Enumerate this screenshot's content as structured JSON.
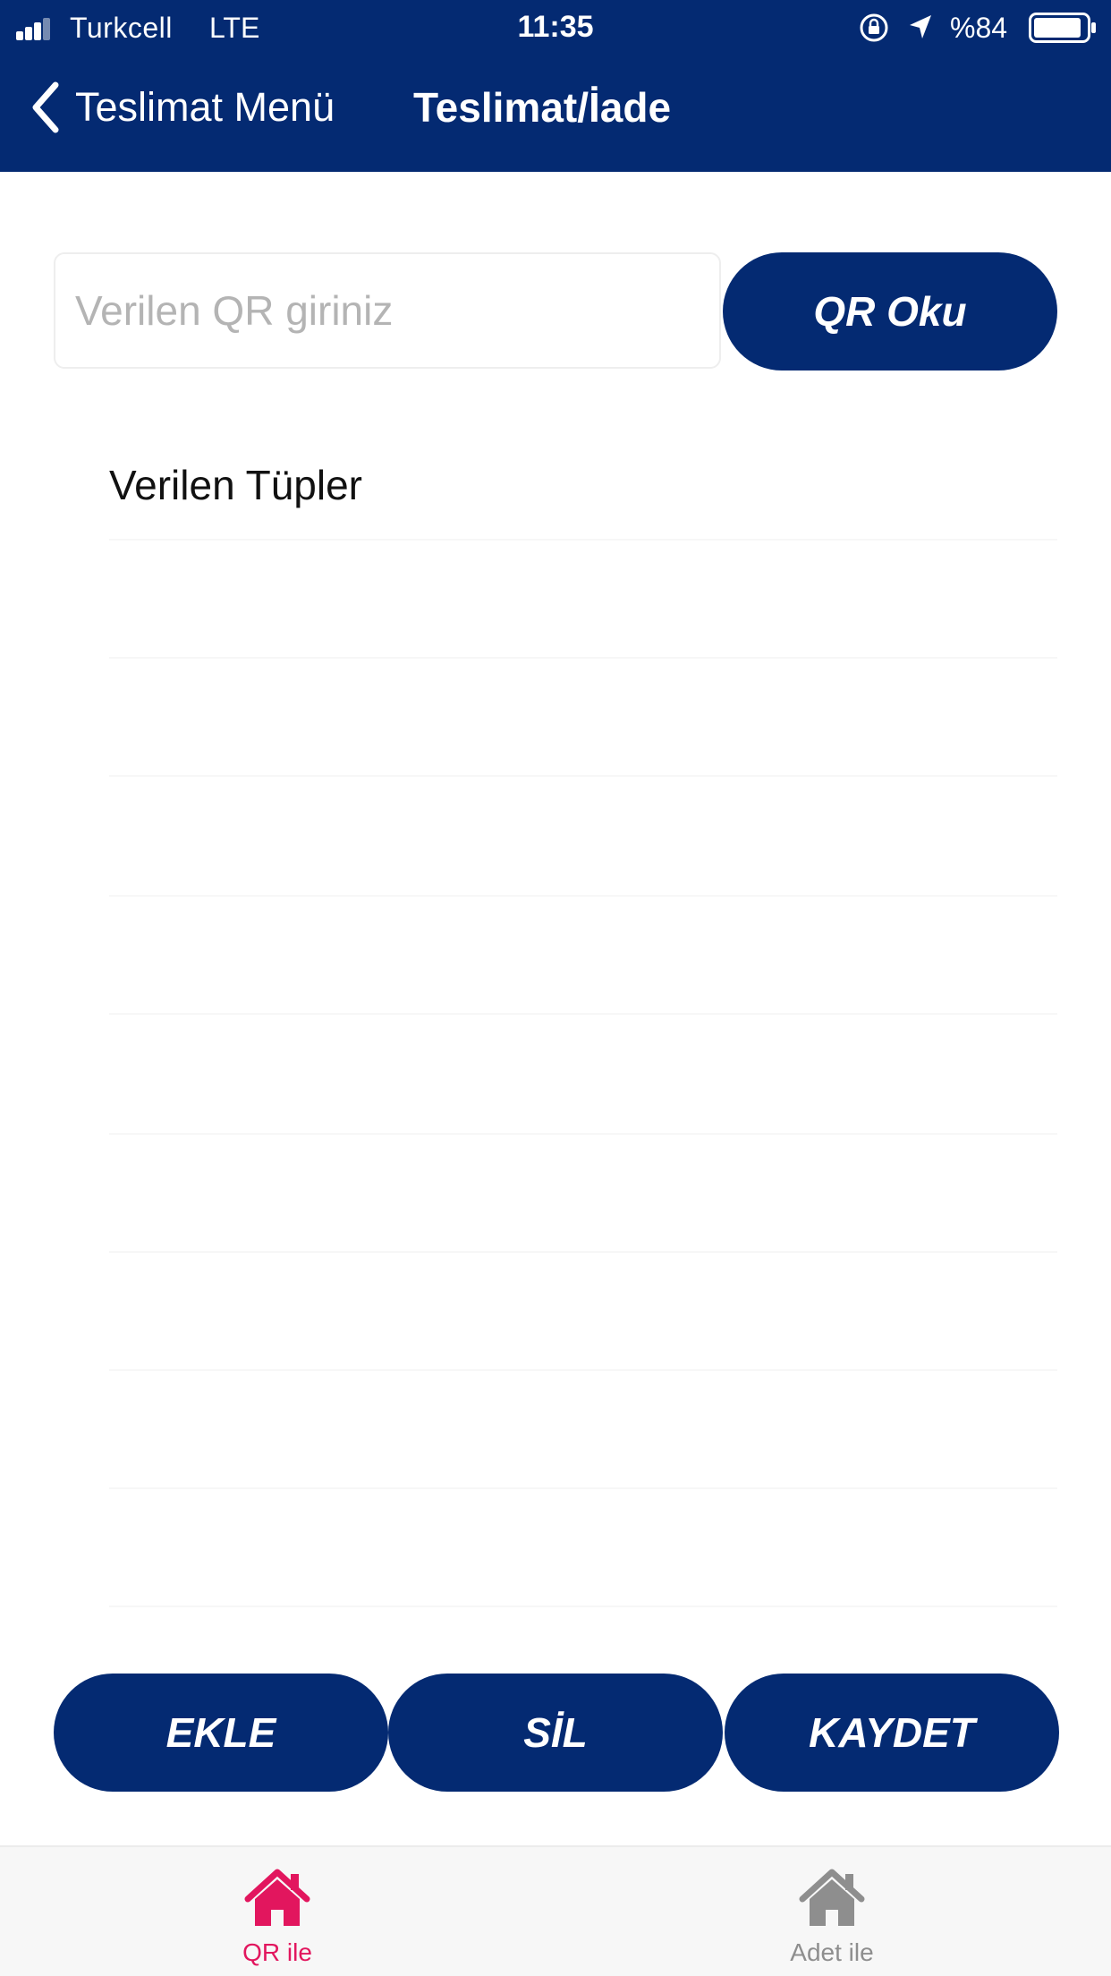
{
  "status_bar": {
    "carrier": "Turkcell",
    "network": "LTE",
    "time": "11:35",
    "battery": "%84",
    "icons": [
      "signal-icon",
      "orientation-lock-icon",
      "location-icon",
      "battery-icon"
    ]
  },
  "nav": {
    "back_label": "Teslimat Menü",
    "title": "Teslimat/İade"
  },
  "qr": {
    "placeholder": "Verilen QR giriniz",
    "value": "",
    "read_button": "QR Oku"
  },
  "list": {
    "header": "Verilen Tüpler",
    "items": []
  },
  "actions": {
    "add": "EKLE",
    "delete": "SİL",
    "save": "KAYDET"
  },
  "tabs": [
    {
      "label": "QR ile",
      "icon": "home-icon",
      "active": true
    },
    {
      "label": "Adet ile",
      "icon": "home-icon",
      "active": false
    }
  ],
  "colors": {
    "primary": "#042a72",
    "tab_active": "#e2165e",
    "tab_inactive": "#8e8e8e",
    "placeholder": "#b4b4b4"
  }
}
